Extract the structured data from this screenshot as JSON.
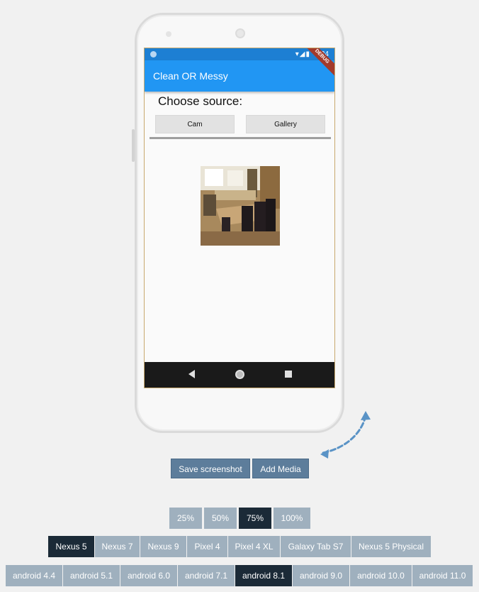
{
  "app": {
    "title": "Clean OR Messy",
    "status_time": "5:34",
    "status_icons": "▾◢▮",
    "debug_label": "DEBUG"
  },
  "main": {
    "heading": "Choose source:",
    "cam_label": "Cam",
    "gallery_label": "Gallery"
  },
  "toolbar": {
    "save_label": "Save screenshot",
    "add_media_label": "Add Media"
  },
  "zoom": {
    "options": [
      "25%",
      "50%",
      "75%",
      "100%"
    ],
    "selected": "75%"
  },
  "devices": {
    "options": [
      "Nexus 5",
      "Nexus 7",
      "Nexus 9",
      "Pixel 4",
      "Pixel 4 XL",
      "Galaxy Tab S7",
      "Nexus 5 Physical"
    ],
    "selected": "Nexus 5"
  },
  "versions": {
    "options": [
      "android 4.4",
      "android 5.1",
      "android 6.0",
      "android 7.1",
      "android 8.1",
      "android 9.0",
      "android 10.0",
      "android 11.0"
    ],
    "selected": "android 8.1"
  },
  "colors": {
    "appbar": "#2196f3",
    "button": "#5d7d9b",
    "selected": "#1b2a37",
    "option": "#9fb0be"
  }
}
